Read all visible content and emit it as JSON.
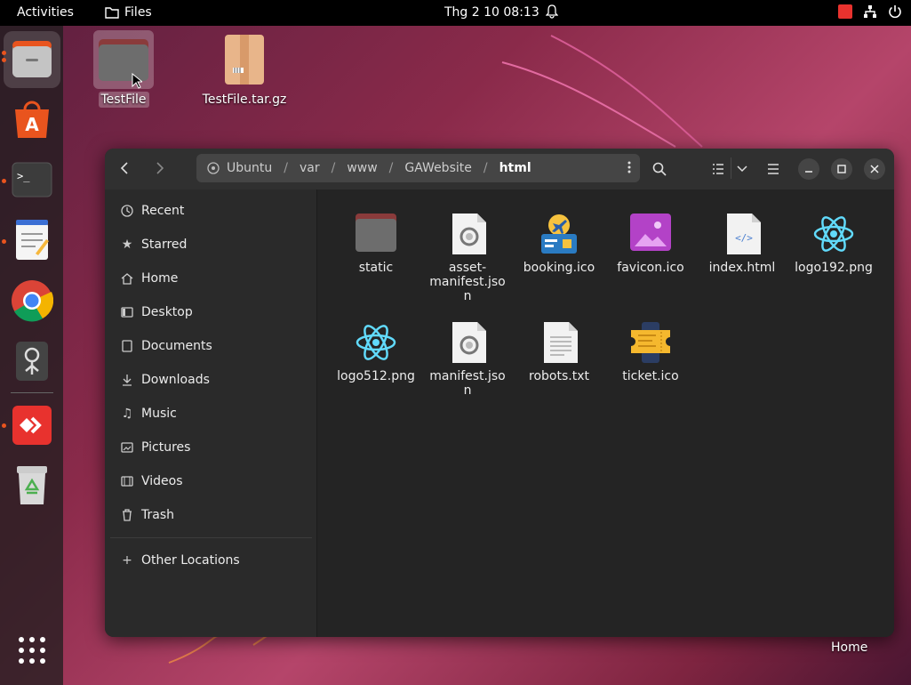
{
  "topbar": {
    "activities": "Activities",
    "app_name": "Files",
    "clock": "Thg 2 10  08:13"
  },
  "desktop": {
    "items": [
      {
        "label": "TestFile",
        "icon": "folder-icon"
      },
      {
        "label": "TestFile.tar.gz",
        "icon": "archive-icon"
      }
    ],
    "home_label": "Home"
  },
  "dock": {
    "items": [
      {
        "name": "files",
        "icon": "file-manager-icon"
      },
      {
        "name": "software",
        "icon": "app-store-icon"
      },
      {
        "name": "terminal",
        "icon": "terminal-icon"
      },
      {
        "name": "text-editor",
        "icon": "text-editor-icon"
      },
      {
        "name": "chrome",
        "icon": "chrome-icon"
      },
      {
        "name": "screenshot",
        "icon": "webcam-icon"
      },
      {
        "name": "anydesk",
        "icon": "anydesk-icon"
      },
      {
        "name": "trash",
        "icon": "trash-icon"
      }
    ]
  },
  "window": {
    "path": {
      "root": "Ubuntu",
      "segments": [
        "var",
        "www",
        "GAWebsite"
      ],
      "current": "html"
    },
    "sidebar": {
      "items": [
        {
          "label": "Recent",
          "icon": "clock-icon"
        },
        {
          "label": "Starred",
          "icon": "star-icon"
        },
        {
          "label": "Home",
          "icon": "home-icon"
        },
        {
          "label": "Desktop",
          "icon": "desktop-icon"
        },
        {
          "label": "Documents",
          "icon": "document-icon"
        },
        {
          "label": "Downloads",
          "icon": "download-icon"
        },
        {
          "label": "Music",
          "icon": "music-icon"
        },
        {
          "label": "Pictures",
          "icon": "pictures-icon"
        },
        {
          "label": "Videos",
          "icon": "video-icon"
        },
        {
          "label": "Trash",
          "icon": "trash-icon"
        }
      ],
      "other_locations": "Other Locations"
    },
    "files": [
      {
        "name": "static",
        "type": "folder"
      },
      {
        "name": "asset-\nmanifest.jso\nn",
        "type": "json"
      },
      {
        "name": "booking.ico",
        "type": "ico-booking"
      },
      {
        "name": "favicon.ico",
        "type": "ico-image"
      },
      {
        "name": "index.html",
        "type": "html"
      },
      {
        "name": "logo192.png",
        "type": "react"
      },
      {
        "name": "logo512.png",
        "type": "react"
      },
      {
        "name": "manifest.jso\nn",
        "type": "json"
      },
      {
        "name": "robots.txt",
        "type": "text"
      },
      {
        "name": "ticket.ico",
        "type": "ico-ticket"
      }
    ]
  }
}
